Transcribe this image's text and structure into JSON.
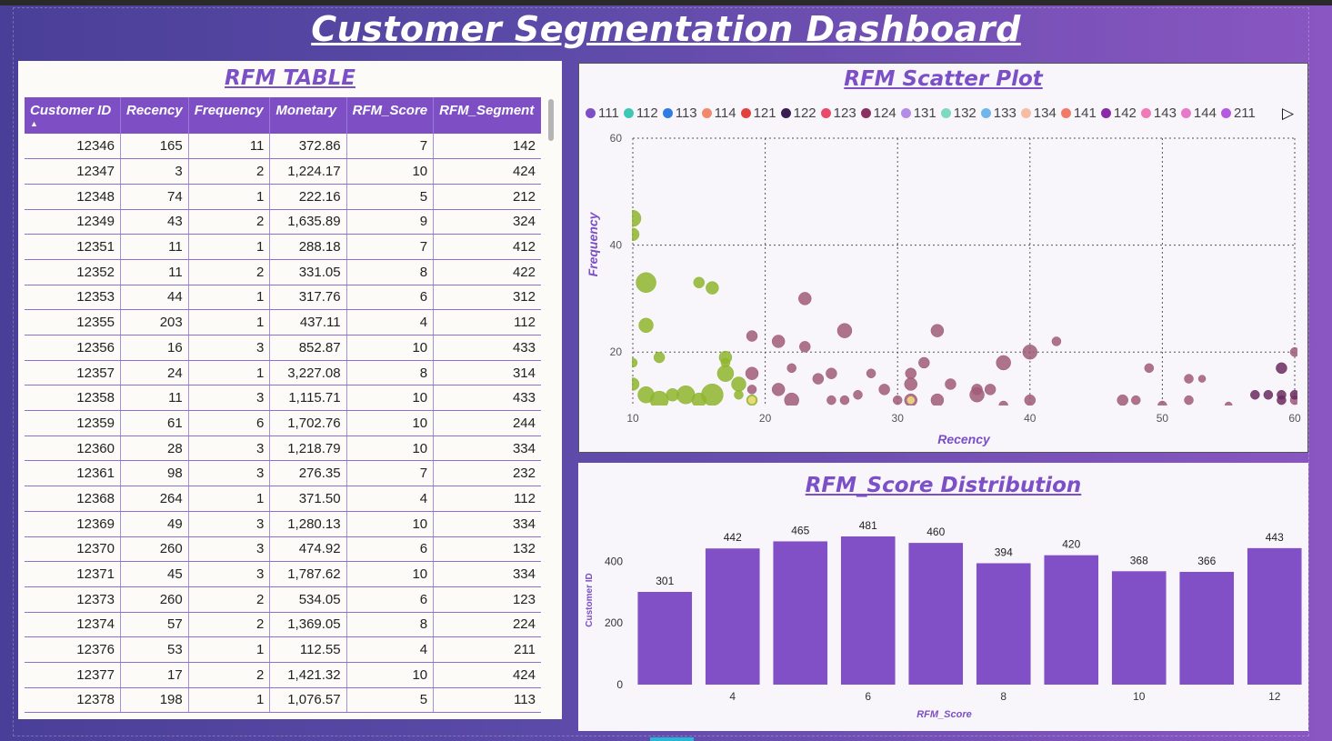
{
  "dashboard": {
    "title": "Customer Segmentation Dashboard"
  },
  "table": {
    "title": "RFM TABLE",
    "columns": [
      "Customer ID",
      "Recency",
      "Frequency",
      "Monetary",
      "RFM_Score",
      "RFM_Segment"
    ],
    "sort_indicator": "▲",
    "rows": [
      [
        "12346",
        "165",
        "11",
        "372.86",
        "7",
        "142"
      ],
      [
        "12347",
        "3",
        "2",
        "1,224.17",
        "10",
        "424"
      ],
      [
        "12348",
        "74",
        "1",
        "222.16",
        "5",
        "212"
      ],
      [
        "12349",
        "43",
        "2",
        "1,635.89",
        "9",
        "324"
      ],
      [
        "12351",
        "11",
        "1",
        "288.18",
        "7",
        "412"
      ],
      [
        "12352",
        "11",
        "2",
        "331.05",
        "8",
        "422"
      ],
      [
        "12353",
        "44",
        "1",
        "317.76",
        "6",
        "312"
      ],
      [
        "12355",
        "203",
        "1",
        "437.11",
        "4",
        "112"
      ],
      [
        "12356",
        "16",
        "3",
        "852.87",
        "10",
        "433"
      ],
      [
        "12357",
        "24",
        "1",
        "3,227.08",
        "8",
        "314"
      ],
      [
        "12358",
        "11",
        "3",
        "1,115.71",
        "10",
        "433"
      ],
      [
        "12359",
        "61",
        "6",
        "1,702.76",
        "10",
        "244"
      ],
      [
        "12360",
        "28",
        "3",
        "1,218.79",
        "10",
        "334"
      ],
      [
        "12361",
        "98",
        "3",
        "276.35",
        "7",
        "232"
      ],
      [
        "12368",
        "264",
        "1",
        "371.50",
        "4",
        "112"
      ],
      [
        "12369",
        "49",
        "3",
        "1,280.13",
        "10",
        "334"
      ],
      [
        "12370",
        "260",
        "3",
        "474.92",
        "6",
        "132"
      ],
      [
        "12371",
        "45",
        "3",
        "1,787.62",
        "10",
        "334"
      ],
      [
        "12373",
        "260",
        "2",
        "534.05",
        "6",
        "123"
      ],
      [
        "12374",
        "57",
        "2",
        "1,369.05",
        "8",
        "224"
      ],
      [
        "12376",
        "53",
        "1",
        "112.55",
        "4",
        "211"
      ],
      [
        "12377",
        "17",
        "2",
        "1,421.32",
        "10",
        "424"
      ],
      [
        "12378",
        "198",
        "1",
        "1,076.57",
        "5",
        "113"
      ]
    ]
  },
  "scatter": {
    "title": "RFM Scatter Plot",
    "next_icon": "play-right-icon",
    "legend": [
      {
        "label": "111",
        "color": "#7d4fc7"
      },
      {
        "label": "112",
        "color": "#3ec7b5"
      },
      {
        "label": "113",
        "color": "#2f7de2"
      },
      {
        "label": "114",
        "color": "#f08a6c"
      },
      {
        "label": "121",
        "color": "#e2423f"
      },
      {
        "label": "122",
        "color": "#3a1e52"
      },
      {
        "label": "123",
        "color": "#e84a6a"
      },
      {
        "label": "124",
        "color": "#8b2e62"
      },
      {
        "label": "131",
        "color": "#b48be8"
      },
      {
        "label": "132",
        "color": "#7ed9c2"
      },
      {
        "label": "133",
        "color": "#6fb7ea"
      },
      {
        "label": "134",
        "color": "#f6bda4"
      },
      {
        "label": "141",
        "color": "#f07a6a"
      },
      {
        "label": "142",
        "color": "#8a2aa8"
      },
      {
        "label": "143",
        "color": "#f07ab5"
      },
      {
        "label": "144",
        "color": "#e67ac9"
      },
      {
        "label": "211",
        "color": "#b55ae0"
      }
    ]
  },
  "bars": {
    "title": "RFM_Score Distribution"
  },
  "chart_data": [
    {
      "type": "scatter",
      "title": "RFM Scatter Plot",
      "xlabel": "Recency",
      "ylabel": "Frequency",
      "xlim": [
        10,
        60
      ],
      "ylim": [
        10,
        60
      ],
      "x_ticks": [
        "10",
        "20",
        "30",
        "40",
        "50",
        "60"
      ],
      "y_ticks": [
        "20",
        "40",
        "60"
      ],
      "grid": true,
      "legend_placement": "top",
      "series": [
        {
          "color": "#8fb52e",
          "points": [
            [
              10,
              45,
              9
            ],
            [
              10,
              42,
              7
            ],
            [
              11,
              33,
              11
            ],
            [
              11,
              25,
              8
            ],
            [
              12,
              19,
              6
            ],
            [
              15,
              33,
              6
            ],
            [
              16,
              32,
              7
            ],
            [
              17,
              19,
              7
            ],
            [
              17,
              16,
              9
            ],
            [
              16,
              12,
              12
            ],
            [
              14,
              12,
              10
            ],
            [
              18,
              14,
              8
            ],
            [
              11,
              12,
              9
            ],
            [
              10,
              14,
              7
            ],
            [
              12,
              11,
              10
            ],
            [
              15,
              11,
              8
            ],
            [
              19,
              11,
              6
            ],
            [
              18,
              12,
              5
            ],
            [
              13,
              12,
              7
            ],
            [
              10,
              18,
              5
            ],
            [
              17,
              18,
              5
            ]
          ]
        },
        {
          "color": "#a05a78",
          "points": [
            [
              19,
              23,
              6
            ],
            [
              19,
              16,
              7
            ],
            [
              21,
              22,
              7
            ],
            [
              22,
              17,
              5
            ],
            [
              23,
              30,
              7
            ],
            [
              23,
              21,
              6
            ],
            [
              26,
              24,
              8
            ],
            [
              21,
              13,
              7
            ],
            [
              24,
              15,
              6
            ],
            [
              25,
              16,
              6
            ],
            [
              22,
              11,
              8
            ],
            [
              25,
              11,
              5
            ],
            [
              27,
              12,
              5
            ],
            [
              29,
              13,
              6
            ],
            [
              31,
              16,
              6
            ],
            [
              32,
              18,
              6
            ],
            [
              31,
              14,
              7
            ],
            [
              30,
              11,
              5
            ],
            [
              31,
              11,
              7
            ],
            [
              33,
              11,
              7
            ],
            [
              33,
              24,
              7
            ],
            [
              36,
              13,
              6
            ],
            [
              38,
              18,
              8
            ],
            [
              40,
              20,
              8
            ],
            [
              36,
              12,
              8
            ],
            [
              40,
              11,
              6
            ],
            [
              42,
              22,
              5
            ],
            [
              47,
              11,
              6
            ],
            [
              48,
              11,
              5
            ],
            [
              49,
              17,
              5
            ],
            [
              50,
              10,
              5
            ],
            [
              52,
              15,
              5
            ],
            [
              52,
              11,
              5
            ],
            [
              53,
              15,
              4
            ],
            [
              60,
              20,
              5
            ],
            [
              60,
              11,
              5
            ],
            [
              37,
              13,
              6
            ],
            [
              28,
              16,
              5
            ],
            [
              34,
              14,
              6
            ],
            [
              26,
              11,
              5
            ],
            [
              19,
              13,
              5
            ],
            [
              38,
              10,
              5
            ],
            [
              55,
              10,
              4
            ]
          ]
        },
        {
          "color": "#6b2a60",
          "points": [
            [
              57,
              12,
              5
            ],
            [
              58,
              12,
              5
            ],
            [
              59,
              12,
              5
            ],
            [
              59,
              17,
              6
            ],
            [
              60,
              12,
              5
            ],
            [
              59,
              11,
              5
            ]
          ]
        },
        {
          "color": "#f4df7a",
          "points": [
            [
              31,
              11,
              4
            ],
            [
              19,
              11,
              4
            ]
          ]
        }
      ]
    },
    {
      "type": "bar",
      "title": "RFM_Score Distribution",
      "xlabel": "RFM_Score",
      "ylabel": "Customer ID",
      "categories": [
        "3",
        "4",
        "5",
        "6",
        "7",
        "8",
        "9",
        "10",
        "11",
        "12"
      ],
      "x_tick_labels": [
        "",
        "4",
        "",
        "6",
        "",
        "8",
        "",
        "10",
        "",
        "12"
      ],
      "values": [
        301,
        442,
        465,
        481,
        460,
        394,
        420,
        368,
        366,
        443
      ],
      "ylim": [
        0,
        481
      ],
      "y_ticks": [
        "0",
        "200",
        "400"
      ],
      "bar_color": "#8150c6"
    }
  ]
}
